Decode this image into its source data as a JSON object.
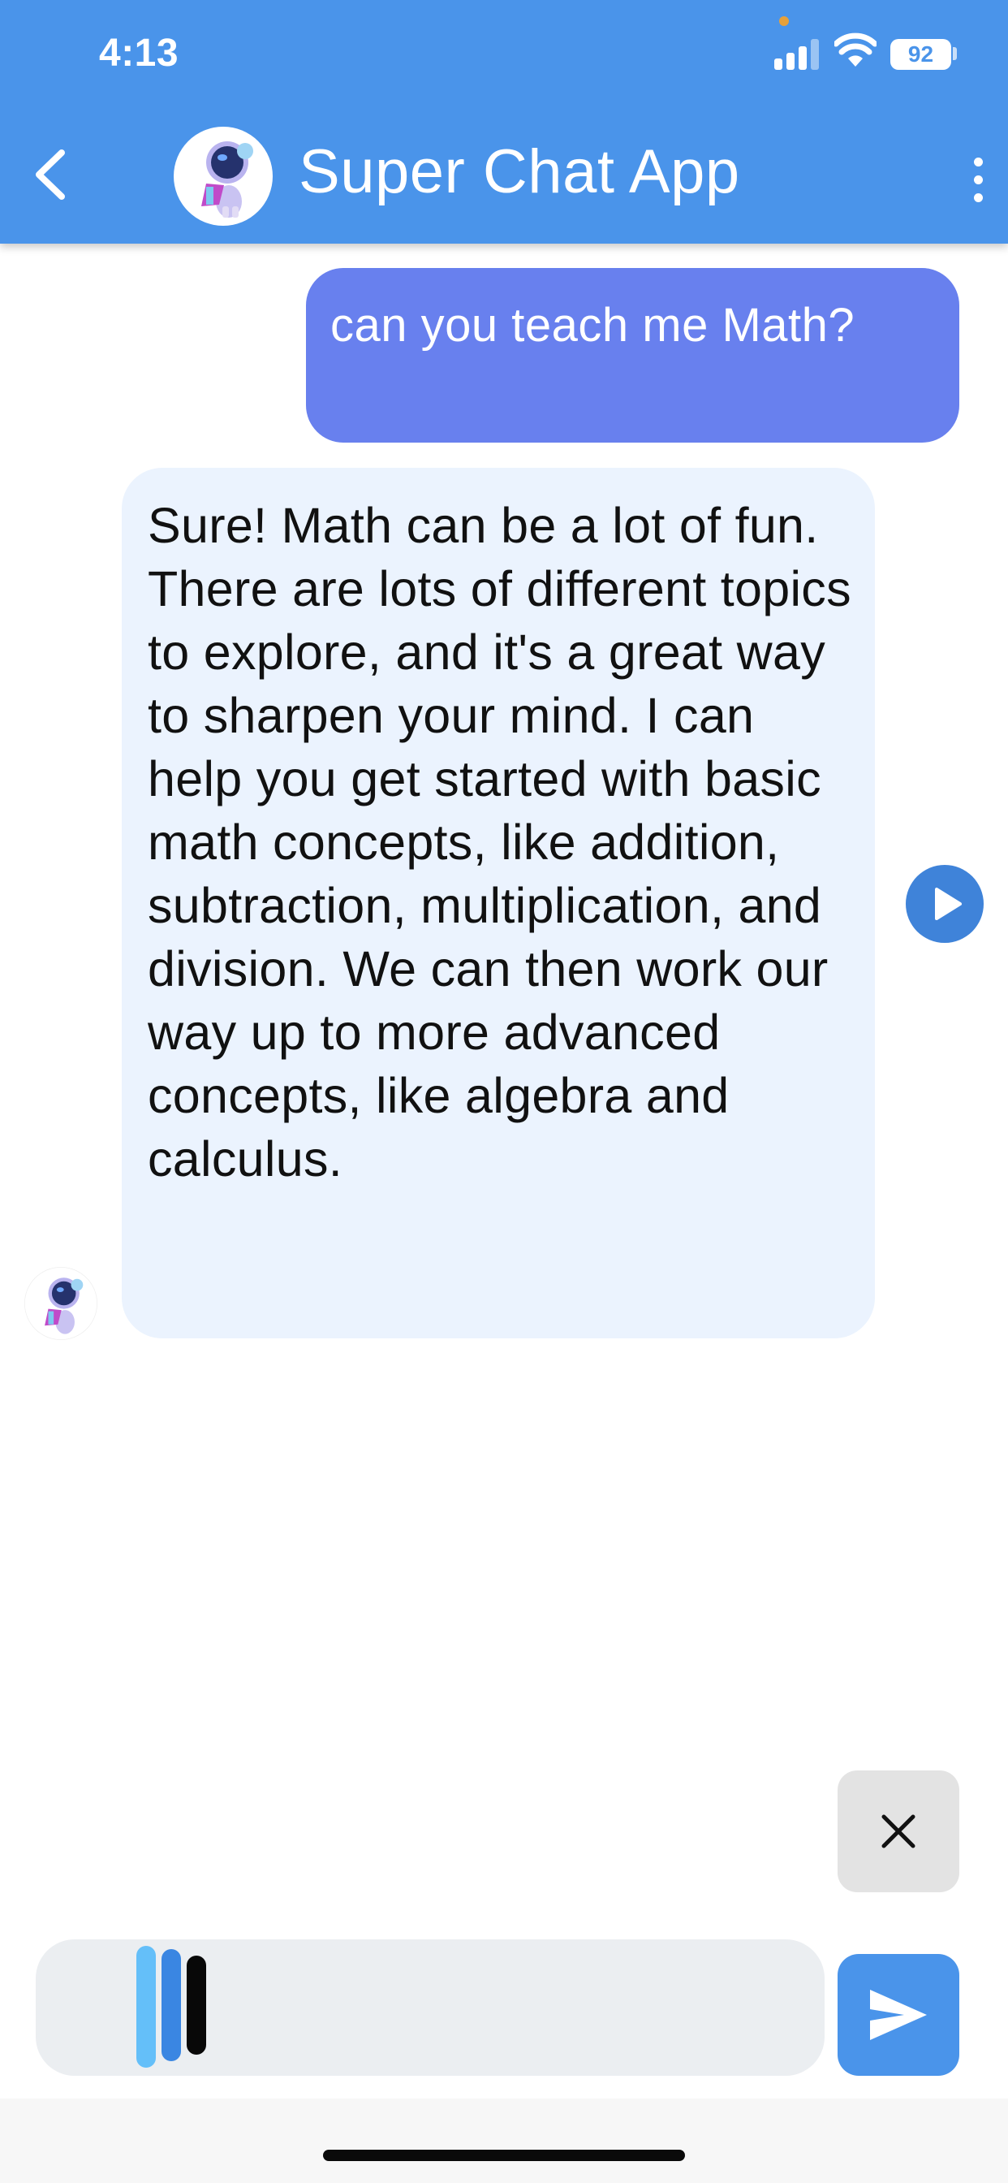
{
  "status_bar": {
    "time": "4:13",
    "battery": "92"
  },
  "header": {
    "title": "Super Chat App",
    "avatar_icon": "astronaut-robot-avatar",
    "back_icon": "chevron-left-icon",
    "menu_icon": "more-vert-icon"
  },
  "messages": [
    {
      "sender": "user",
      "text": "can you teach me Math?"
    },
    {
      "sender": "bot",
      "text": "Sure! Math can be a lot of fun. There are lots of different topics to explore, and it's a great way to sharpen your mind. I can help you get started with basic math concepts, like addition, subtraction, multiplication, and division. We can then work our way up to more advanced concepts, like algebra and calculus."
    }
  ],
  "controls": {
    "play_icon": "play-icon",
    "cancel_icon": "close-icon",
    "send_icon": "send-icon",
    "recording_icon": "audio-waveform-icon"
  },
  "colors": {
    "app_bar": "#4a94ea",
    "user_bubble": "#6880ee",
    "bot_bubble": "#ebf3fe",
    "play_button": "#3f83d9",
    "send_button": "#4a94ea"
  }
}
